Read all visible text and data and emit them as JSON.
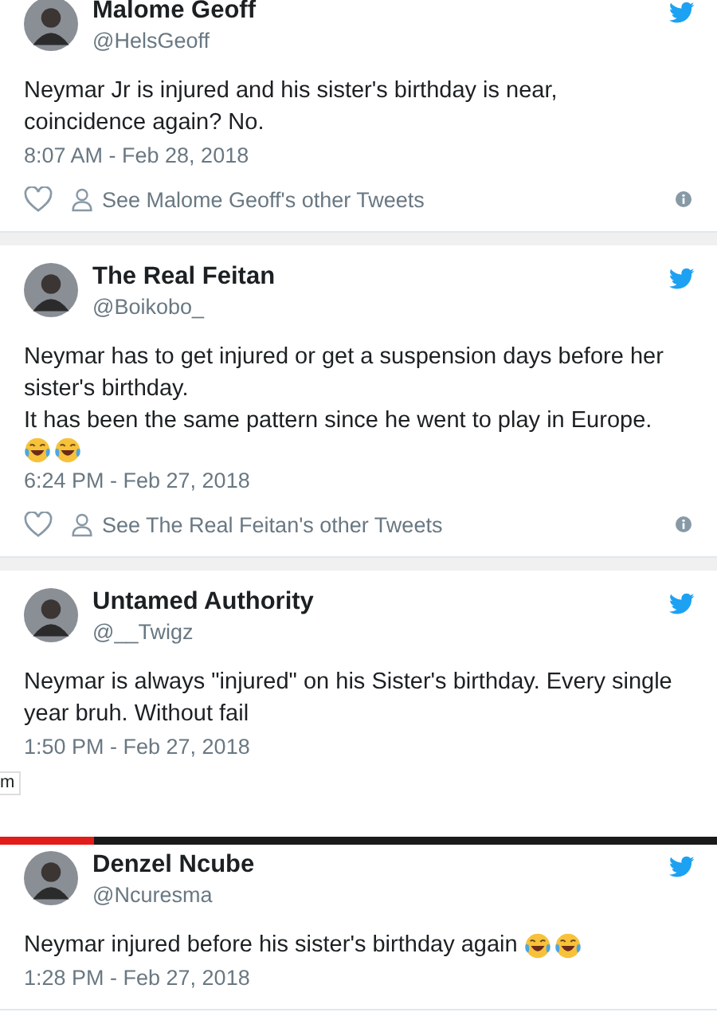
{
  "tweets": [
    {
      "name": "Malome Geoff",
      "handle": "@HelsGeoff",
      "body": [
        [
          {
            "kind": "text",
            "text": "Neymar Jr is injured and his sister's birthday is near,"
          }
        ],
        [
          {
            "kind": "text",
            "text": "coincidence again? No."
          }
        ]
      ],
      "time": "8:07 AM - Feb 28, 2018",
      "footer": "See Malome Geoff's other Tweets"
    },
    {
      "name": "The Real Feitan",
      "handle": "@Boikobo_",
      "body": [
        [
          {
            "kind": "text",
            "text": "Neymar has to get injured or get a suspension days before her"
          }
        ],
        [
          {
            "kind": "text",
            "text": "sister's birthday."
          }
        ],
        [
          {
            "kind": "text",
            "text": "It has been the same pattern since he went to play in Europe."
          }
        ],
        [
          {
            "kind": "emoji"
          },
          {
            "kind": "emoji"
          }
        ]
      ],
      "time": "6:24 PM - Feb 27, 2018",
      "footer": "See The Real Feitan's other Tweets"
    },
    {
      "name": "Untamed Authority",
      "handle": "@__Twigz",
      "body": [
        [
          {
            "kind": "text",
            "text": "Neymar is always \"injured\" on his Sister's birthday. Every single"
          }
        ],
        [
          {
            "kind": "text",
            "text": "year bruh. Without fail"
          }
        ]
      ],
      "time": "1:50 PM - Feb 27, 2018",
      "clipped": true
    },
    {
      "name": "Denzel Ncube",
      "handle": "@Ncuresma",
      "progress": {
        "level": 0.13
      },
      "body": [
        [
          {
            "kind": "text",
            "text": "Neymar injured before his sister's birthday again "
          },
          {
            "kind": "emoji"
          },
          {
            "kind": "emoji"
          }
        ]
      ],
      "time": "1:28 PM - Feb 27, 2018"
    }
  ],
  "overlay_fragment": "m"
}
